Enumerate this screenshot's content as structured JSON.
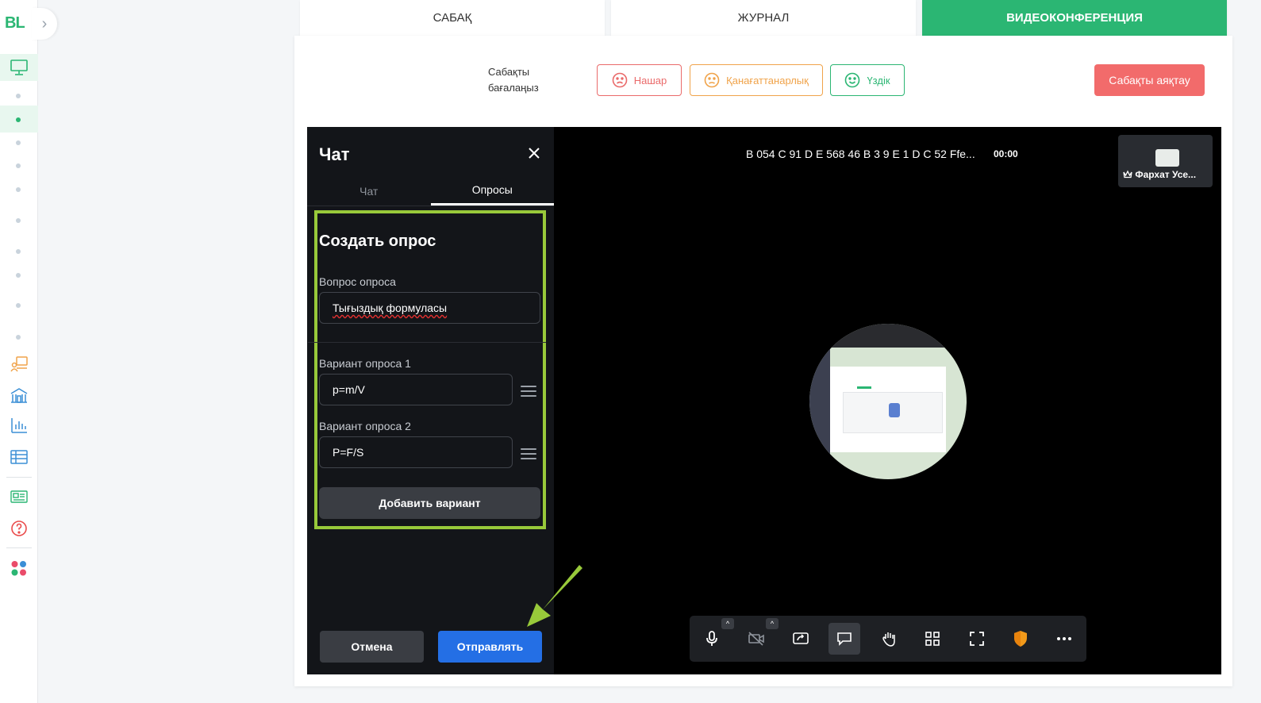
{
  "sidebar": {
    "logo": "BL",
    "expand_icon": "chevron-right-icon",
    "icons": [
      "monitor-icon",
      "presenter-icon",
      "school-icon",
      "bar-chart-icon",
      "table-icon",
      "newspaper-icon",
      "help-icon",
      "apps-icon"
    ]
  },
  "tabs": [
    {
      "label": "САБАҚ"
    },
    {
      "label": "ЖУРНАЛ"
    },
    {
      "label": "ВИДЕОКОНФЕРЕНЦИЯ"
    }
  ],
  "rating": {
    "label": "Сабақты бағалаңыз",
    "bad": "Нашар",
    "mid": "Қанағаттанарлық",
    "good": "Үздік"
  },
  "end_lesson": "Сабақты аяқтау",
  "chat": {
    "title": "Чат",
    "tabs": [
      "Чат",
      "Опросы"
    ],
    "active_tab": "Опросы"
  },
  "poll": {
    "title": "Создать опрос",
    "question_label": "Вопрос опроса",
    "question_value": "Тығыздық формуласы",
    "options": [
      {
        "label": "Вариант опроса 1",
        "value": "p=m/V"
      },
      {
        "label": "Вариант опроса 2",
        "value": "P=F/S"
      }
    ],
    "add_option": "Добавить вариант",
    "cancel": "Отмена",
    "send": "Отправлять"
  },
  "meeting": {
    "id": "B 054 C 91 D E 568 46 B 3 9 E 1 D C 52 Ffe...",
    "time": "00:00",
    "participant_name": "Фархат Усе..."
  },
  "toolbar": {
    "icons": [
      "microphone-icon",
      "camera-off-icon",
      "screen-share-icon",
      "chat-icon",
      "raise-hand-icon",
      "tile-view-icon",
      "fullscreen-icon",
      "security-shield-icon",
      "more-icon"
    ],
    "active": "chat-icon"
  },
  "colors": {
    "brand_green": "#2bb673",
    "danger": "#f26b6b",
    "warning": "#f0a34a",
    "primary_blue": "#246fe5",
    "highlight": "#98c93a"
  }
}
